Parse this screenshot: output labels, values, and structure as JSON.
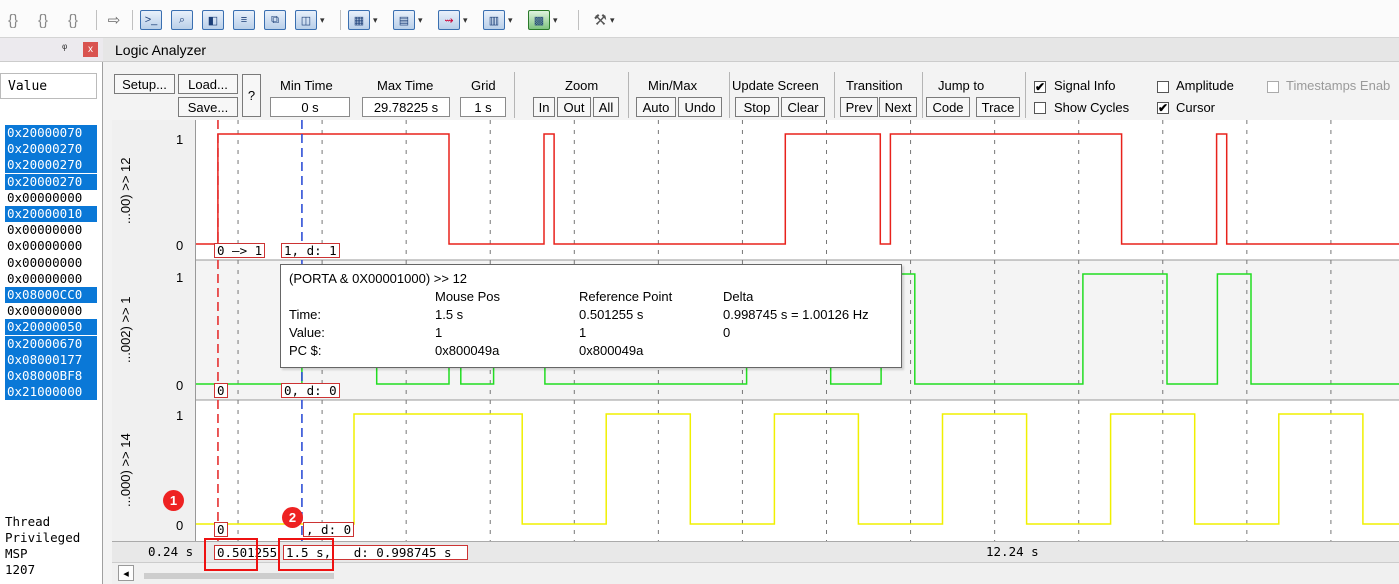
{
  "toolbar": {
    "left_icons": [
      "{}",
      "{}",
      "{}"
    ],
    "items": [
      {
        "name": "run-arrow-icon",
        "glyph": "⇨"
      },
      {
        "name": "command-window-icon",
        "glyph": ">_"
      },
      {
        "name": "disassembly-icon",
        "glyph": "⌕"
      },
      {
        "name": "symbols-icon",
        "glyph": "◧"
      },
      {
        "name": "registers-icon",
        "glyph": "≡"
      },
      {
        "name": "call-stack-icon",
        "glyph": "⧉"
      },
      {
        "name": "watch-icon",
        "glyph": "◫"
      },
      {
        "name": "memory-icon",
        "glyph": "▦"
      },
      {
        "name": "serial-icon",
        "glyph": "▤"
      },
      {
        "name": "analysis-icon",
        "glyph": "⇝"
      },
      {
        "name": "trace-icon",
        "glyph": "▥"
      },
      {
        "name": "system-viewer-icon",
        "glyph": "▩"
      },
      {
        "name": "tools-icon",
        "glyph": "⚒"
      }
    ]
  },
  "left_panel": {
    "pin": "ᵠ",
    "close": "x",
    "value_header": "Value",
    "values": [
      {
        "text": "0x20000070",
        "selected": true
      },
      {
        "text": "0x20000270",
        "selected": true
      },
      {
        "text": "0x20000270",
        "selected": true
      },
      {
        "text": "0x20000270",
        "selected": true
      },
      {
        "text": "0x00000000",
        "selected": false
      },
      {
        "text": "0x20000010",
        "selected": true
      },
      {
        "text": "0x00000000",
        "selected": false
      },
      {
        "text": "0x00000000",
        "selected": false
      },
      {
        "text": "0x00000000",
        "selected": false
      },
      {
        "text": "0x00000000",
        "selected": false
      },
      {
        "text": "0x08000CC0",
        "selected": true
      },
      {
        "text": "0x00000000",
        "selected": false
      },
      {
        "text": "0x20000050",
        "selected": true
      },
      {
        "text": "0x20000670",
        "selected": true
      },
      {
        "text": "0x08000177",
        "selected": true
      },
      {
        "text": "0x08000BF8",
        "selected": true
      },
      {
        "text": "0x21000000",
        "selected": true
      }
    ],
    "thread": [
      "Thread",
      "Privileged",
      "MSP",
      "1207"
    ]
  },
  "analyzer": {
    "title": "Logic Analyzer",
    "setup": "Setup...",
    "load": "Load...",
    "save": "Save...",
    "help": "?",
    "min_time_label": "Min Time",
    "min_time": "0 s",
    "max_time_label": "Max Time",
    "max_time": "29.78225 s",
    "grid_label": "Grid",
    "grid": "1 s",
    "zoom_label": "Zoom",
    "zoom_in": "In",
    "zoom_out": "Out",
    "zoom_all": "All",
    "minmax_label": "Min/Max",
    "auto": "Auto",
    "undo": "Undo",
    "update_label": "Update Screen",
    "stop": "Stop",
    "clear": "Clear",
    "transition_label": "Transition",
    "prev": "Prev",
    "next": "Next",
    "jump_label": "Jump to",
    "code": "Code",
    "trace": "Trace",
    "signal_info": {
      "label": "Signal Info",
      "checked": true
    },
    "amplitude": {
      "label": "Amplitude",
      "checked": false
    },
    "timestamps": {
      "label": "Timestamps Enab",
      "checked": false
    },
    "show_cycles": {
      "label": "Show Cycles",
      "checked": false
    },
    "cursor": {
      "label": "Cursor",
      "checked": true
    },
    "check_mark": "✔"
  },
  "signals": [
    {
      "name": "...00) >> 12",
      "color": "#e8221c",
      "hi": "1",
      "lo": "0",
      "cursor_left": "0 —> 1",
      "cursor_right": "1,   d: 1"
    },
    {
      "name": "...002) >> 1",
      "color": "#22dd22",
      "hi": "1",
      "lo": "0",
      "cursor_left": "0",
      "cursor_right": "0,   d: 0"
    },
    {
      "name": "...000) >> 14",
      "color": "#f0f000",
      "hi": "1",
      "lo": "0",
      "cursor_left": "0",
      "cursor_right": ",  d: 0"
    }
  ],
  "chart_data": {
    "type": "line",
    "x_unit": "s",
    "xlim": [
      0.24,
      14.55
    ],
    "series": [
      {
        "name": "...00) >> 12",
        "edges": [
          0.24,
          0.42,
          0.5,
          3.25,
          4.38,
          4.5,
          7.25,
          8.38,
          8.5,
          11.25,
          12.38,
          12.5,
          14.55
        ],
        "states": [
          0,
          0,
          1,
          0,
          1,
          0,
          1,
          0,
          1,
          0,
          1,
          0
        ]
      },
      {
        "name": "...002) >> 1",
        "edges": [
          0.24,
          1.5,
          2.39,
          3.25,
          3.39,
          3.78,
          4.39,
          6.79,
          7.79,
          8.39,
          8.79,
          10.79,
          11.79,
          12.39,
          12.79,
          14.55
        ],
        "states": [
          0,
          1,
          0,
          1,
          0,
          1,
          0,
          1,
          0,
          1,
          0,
          1,
          0,
          1,
          0
        ]
      },
      {
        "name": "...000) >> 14",
        "edges": [
          0.24,
          2.12,
          4.12,
          5.12,
          6.12,
          7.12,
          8.12,
          9.12,
          10.12,
          11.12,
          12.12,
          13.12,
          14.12,
          14.55
        ],
        "states": [
          0,
          1,
          0,
          1,
          0,
          1,
          0,
          1,
          0,
          1,
          0,
          1,
          0
        ]
      }
    ],
    "red_cursor": 0.501255,
    "blue_cursor": 1.5,
    "grid_step": 1
  },
  "tooltip": {
    "expr": "(PORTA & 0X00001000) >> 12",
    "col_mouse": "Mouse Pos",
    "col_ref": "Reference Point",
    "col_delta": "Delta",
    "rows": [
      {
        "label": "Time:",
        "mouse": "1.5 s",
        "ref": "0.501255 s",
        "delta": "0.998745 s = 1.00126 Hz"
      },
      {
        "label": "Value:",
        "mouse": "1",
        "ref": "1",
        "delta": "0"
      },
      {
        "label": "PC $:",
        "mouse": "0x800049a",
        "ref": "0x800049a",
        "delta": ""
      }
    ]
  },
  "axis": {
    "start": "0.24  s",
    "ref_value": "0.501255",
    "cursor_value": "1.5 s,",
    "delta_value": "d: 0.998745  s",
    "right_value": "12.24  s",
    "scroll_left": "◂"
  },
  "badges": [
    "1",
    "2"
  ]
}
